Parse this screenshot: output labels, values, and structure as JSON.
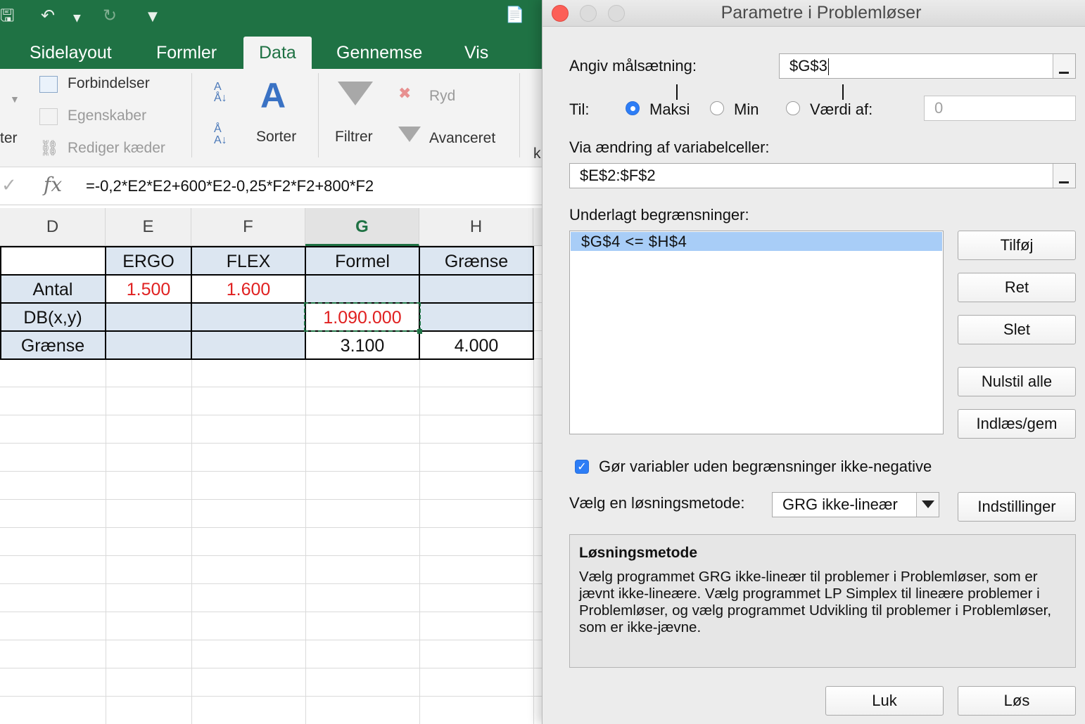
{
  "excel": {
    "tabs": [
      "Sidelayout",
      "Formler",
      "Data",
      "Gennemse",
      "Vis"
    ],
    "active_tab": "Data",
    "ribbon": {
      "connections": "Forbindelser",
      "properties": "Egenskaber",
      "edit_links": "Rediger kæder",
      "left_cut_1": "ter",
      "sort": "Sorter",
      "filter": "Filtrer",
      "clear": "Ryd",
      "advanced": "Avanceret",
      "right_cut": "k"
    },
    "formula_bar": {
      "fx": "fx",
      "formula": "=-0,2*E2*E2+600*E2-0,25*F2*F2+800*F2"
    },
    "columns": [
      "D",
      "E",
      "F",
      "G",
      "H"
    ],
    "selected_column": "G",
    "table": {
      "headers": [
        "",
        "ERGO",
        "FLEX",
        "Formel",
        "Grænse"
      ],
      "rows": [
        {
          "label": "Antal",
          "e": "1.500",
          "f": "1.600",
          "g": "",
          "h": ""
        },
        {
          "label": "DB(x,y)",
          "e": "",
          "f": "",
          "g": "1.090.000",
          "h": ""
        },
        {
          "label": "Grænse",
          "e": "",
          "f": "",
          "g": "3.100",
          "h": "4.000"
        }
      ]
    }
  },
  "dialog": {
    "title": "Parametre i Problemløser",
    "objective_label": "Angiv målsætning:",
    "objective_value": "$G$3",
    "to_label": "Til:",
    "options": {
      "max": "Maksi",
      "min": "Min",
      "value_of": "Værdi af:"
    },
    "selected_option": "max",
    "value_of_value": "0",
    "changing_label": "Via ændring af variabelceller:",
    "changing_value": "$E$2:$F$2",
    "constraints_label": "Underlagt begrænsninger:",
    "constraints": [
      "$G$4 <= $H$4"
    ],
    "buttons": {
      "add": "Tilføj",
      "change": "Ret",
      "delete": "Slet",
      "reset_all": "Nulstil alle",
      "load_save": "Indlæs/gem",
      "options": "Indstillinger",
      "close": "Luk",
      "solve": "Løs"
    },
    "nonneg_label": "Gør variabler uden begrænsninger ikke-negative",
    "nonneg_checked": true,
    "method_label": "Vælg en løsningsmetode:",
    "method_value": "GRG ikke-lineær",
    "method_box": {
      "title": "Løsningsmetode",
      "text": "Vælg programmet GRG ikke-lineær til problemer i Problemløser, som er jævnt ikke-lineære. Vælg programmet LP Simplex til lineære problemer i Problemløser, og vælg programmet Udvikling til problemer i Problemløser, som er ikke-jævne."
    }
  }
}
